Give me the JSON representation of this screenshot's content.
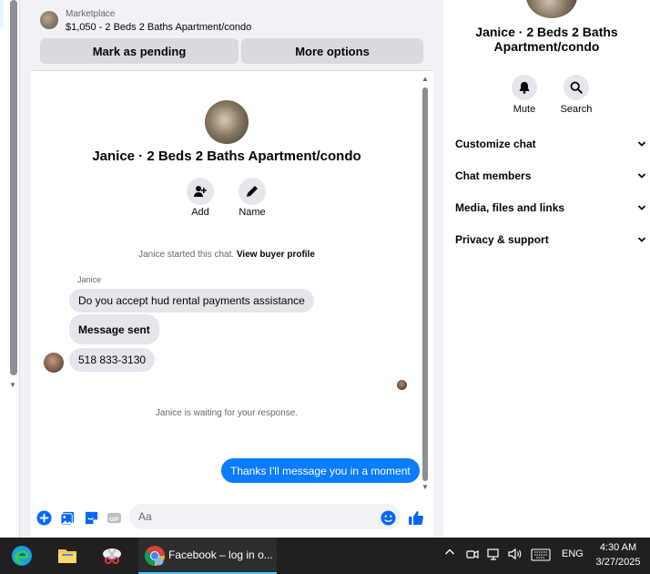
{
  "listing": {
    "kicker": "Marketplace",
    "title": "$1,050 - 2 Beds 2 Baths Apartment/condo",
    "pending_button": "Mark as pending",
    "more_button": "More options"
  },
  "chat": {
    "title": "Janice · 2 Beds 2 Baths Apartment/condo",
    "add_label": "Add",
    "name_label": "Name",
    "started_text": "Janice started this chat.",
    "view_profile": "View buyer profile",
    "sender_name": "Janice",
    "messages_in": [
      "Do you accept hud rental payments assistance",
      "Message sent",
      "518 833-3130"
    ],
    "waiting_text": "Janice is waiting for your response.",
    "message_out": "Thanks I'll message you in a moment",
    "composer_placeholder": "Aa"
  },
  "sidebar": {
    "title": "Janice · 2 Beds 2 Baths Apartment/condo",
    "mute_label": "Mute",
    "search_label": "Search",
    "sections": [
      "Customize chat",
      "Chat members",
      "Media, files and links",
      "Privacy & support"
    ]
  },
  "taskbar": {
    "active_window": "Facebook – log in o...",
    "language": "ENG",
    "time": "4:30 AM",
    "date": "3/27/2025"
  },
  "colors": {
    "accent": "#0a7cff",
    "messenger_icon": "#0866ff",
    "taskbar": "#202020"
  }
}
